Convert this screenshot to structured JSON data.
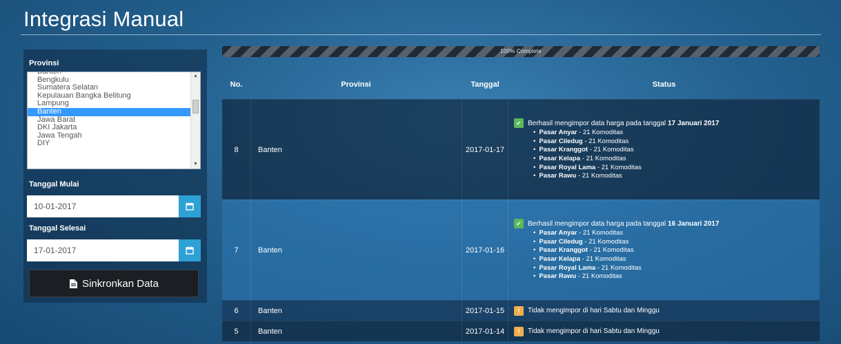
{
  "title": "Integrasi Manual",
  "filters": {
    "province_label": "Provinsi",
    "province_options": [
      "Banten",
      "Bengkulu",
      "Sumatera Selatan",
      "Kepulauan Bangka Belitung",
      "Lampung",
      "Banten",
      "Jawa Barat",
      "DKI Jakarta",
      "Jawa Tengah",
      "DIY"
    ],
    "province_selected_index": 5,
    "start_label": "Tanggal Mulai",
    "start_value": "10-01-2017",
    "end_label": "Tanggal Selesai",
    "end_value": "17-01-2017",
    "sync_label": "Sinkronkan Data"
  },
  "progress": {
    "text": "100% Complete",
    "percent": 100
  },
  "table": {
    "headers": {
      "no": "No.",
      "province": "Provinsi",
      "date": "Tanggal",
      "status": "Status"
    },
    "rows": [
      {
        "no": "8",
        "province": "Banten",
        "date": "2017-01-17",
        "status_prefix": "Berhasil mengimpor data harga pada tanggal",
        "status_date": "17 Januari 2017",
        "markets": [
          {
            "name": "Pasar Anyar",
            "count": "- 21 Komoditas"
          },
          {
            "name": "Pasar Ciledug",
            "count": "- 21 Komoditas"
          },
          {
            "name": "Pasar Kranggot",
            "count": "- 21 Komoditas"
          },
          {
            "name": "Pasar Kelapa",
            "count": "- 21 Komoditas"
          },
          {
            "name": "Pasar Royal Lama",
            "count": "- 21 Komoditas"
          },
          {
            "name": "Pasar Rawu",
            "count": "- 21 Komoditas"
          }
        ]
      },
      {
        "no": "7",
        "province": "Banten",
        "date": "2017-01-16",
        "status_prefix": "Berhasil mengimpor data harga pada tanggal",
        "status_date": "16 Januari 2017",
        "markets": [
          {
            "name": "Pasar Anyar",
            "count": "- 21 Komoditas"
          },
          {
            "name": "Pasar Ciledug",
            "count": "- 21 Komoditas"
          },
          {
            "name": "Pasar Kranggot",
            "count": "- 21 Komoditas"
          },
          {
            "name": "Pasar Kelapa",
            "count": "- 21 Komoditas"
          },
          {
            "name": "Pasar Royal Lama",
            "count": "- 21 Komoditas"
          },
          {
            "name": "Pasar Rawu",
            "count": "- 21 Komoditas"
          }
        ]
      },
      {
        "no": "6",
        "province": "Banten",
        "date": "2017-01-15",
        "status": "Tidak mengimpor di hari Sabtu dan Minggu"
      },
      {
        "no": "5",
        "province": "Banten",
        "date": "2017-01-14",
        "status": "Tidak mengimpor di hari Sabtu dan Minggu"
      }
    ]
  },
  "colors": {
    "success": "#5cb85c",
    "warning": "#f0ad4e",
    "selected": "#3399ff",
    "calendar_button": "#2ea1d4"
  },
  "icons": {
    "calendar": "calendar-icon",
    "file": "file-icon",
    "check": "check-icon",
    "warning": "warning-icon"
  }
}
